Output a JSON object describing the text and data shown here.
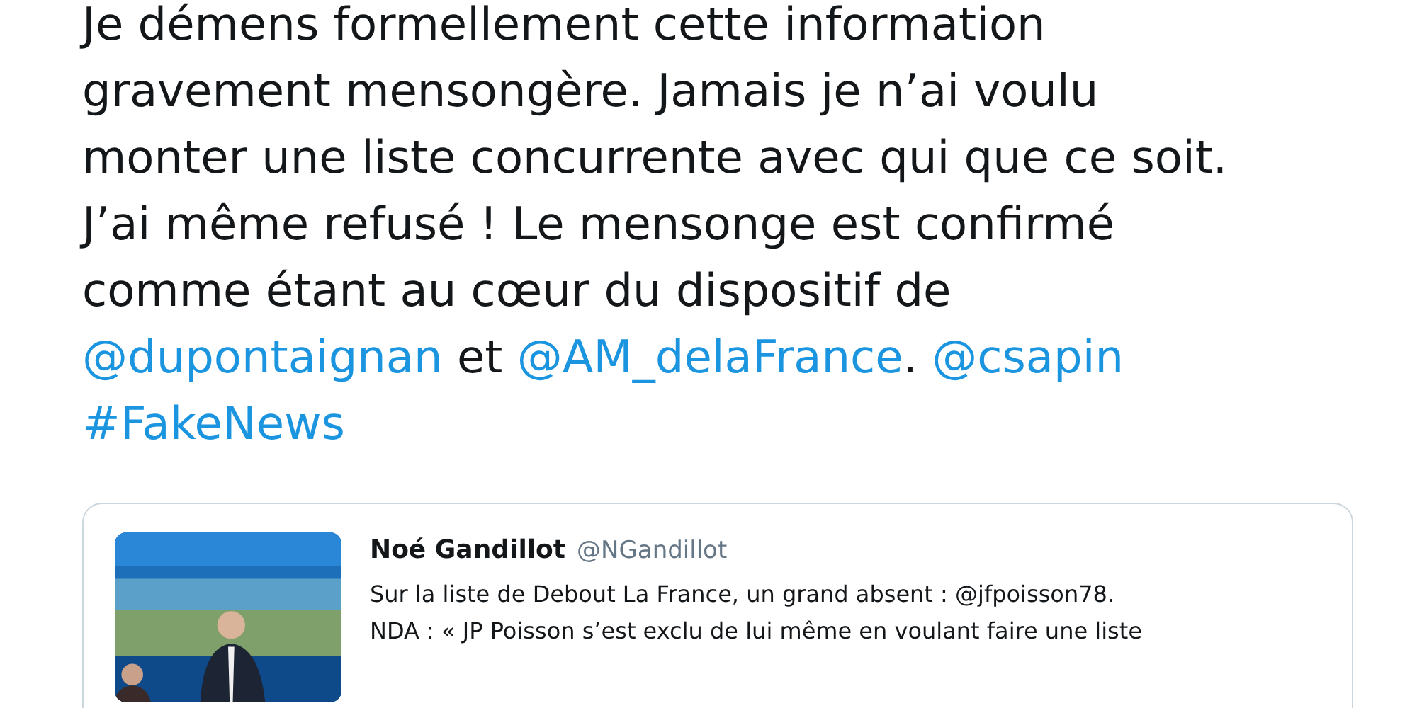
{
  "tweet": {
    "segments": [
      {
        "kind": "text",
        "text": "Je démens formellement cette information gravement mensongère. Jamais je n’ai voulu monter une liste concurrente avec qui que ce soit. J’ai même refusé ! Le mensonge est confirmé comme étant au cœur du dispositif de "
      },
      {
        "kind": "link",
        "text": "@dupontaignan"
      },
      {
        "kind": "text",
        "text": " et "
      },
      {
        "kind": "link",
        "text": "@AM_delaFrance"
      },
      {
        "kind": "text",
        "text": ". "
      },
      {
        "kind": "link",
        "text": "@csapin"
      },
      {
        "kind": "link",
        "text": "#FakeNews"
      }
    ]
  },
  "quoted_tweet": {
    "author_name": "Noé Gandillot",
    "author_handle": "@NGandillot",
    "text_lines": [
      "Sur la liste de Debout La France, un grand absent : @jfpoisson78.",
      "NDA : « JP Poisson s’est exclu de lui même en voulant faire une liste"
    ]
  }
}
